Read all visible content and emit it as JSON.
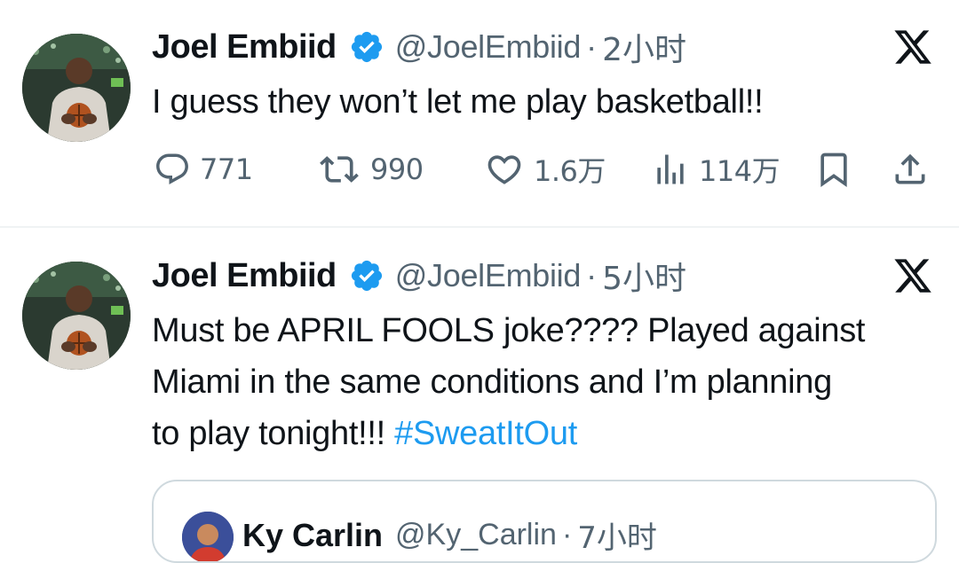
{
  "colors": {
    "text": "#0f1419",
    "secondary": "#536471",
    "link": "#1d9bf0",
    "verified": "#1d9bf0",
    "divider": "#eff3f4"
  },
  "tweets": [
    {
      "author_name": "Joel Embiid",
      "handle": "@JoelEmbiid",
      "separator": "·",
      "time": "2小时",
      "text": "I guess they won’t let me play basketball!!",
      "avatar_icon": "user-avatar",
      "stats": {
        "replies": "771",
        "retweets": "990",
        "likes": "1.6万",
        "views": "114万"
      }
    },
    {
      "author_name": "Joel Embiid",
      "handle": "@JoelEmbiid",
      "separator": "·",
      "time": "5小时",
      "text_lines": [
        "Must be APRIL FOOLS joke???? Played against",
        "Miami in the same conditions and I’m planning",
        "to play tonight!!! "
      ],
      "hashtag": "#SweatItOut",
      "quoted": {
        "author_name": "Ky Carlin",
        "handle": "@Ky_Carlin",
        "separator": "·",
        "time": "7小时"
      }
    }
  ]
}
